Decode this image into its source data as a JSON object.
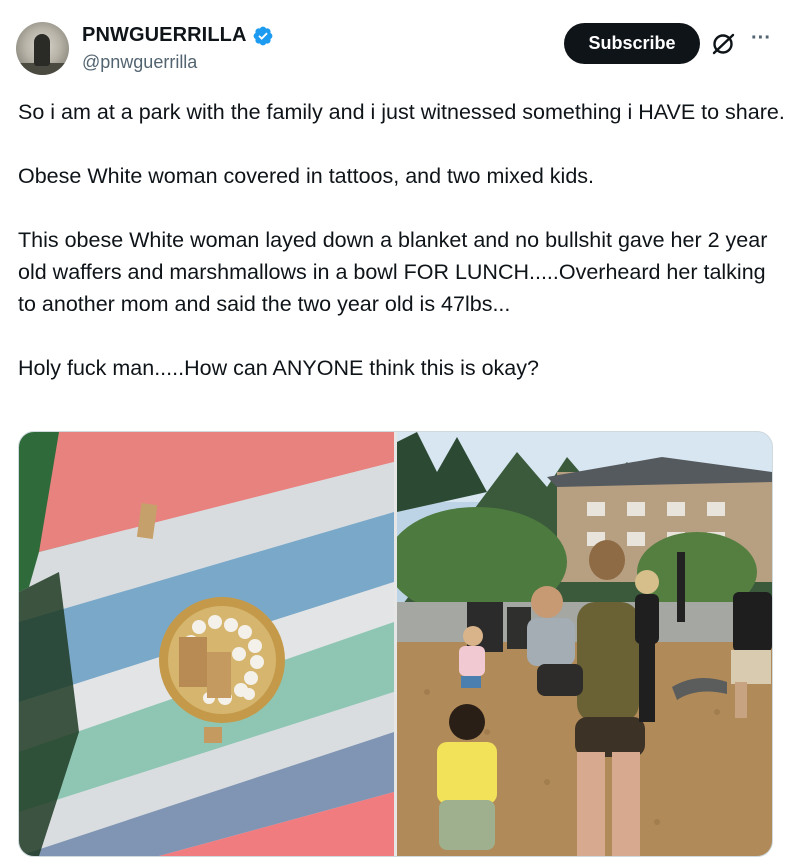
{
  "author": {
    "display_name": "PNWGUERRILLA",
    "handle": "@pnwguerrilla",
    "verified_icon": "verified-badge-icon",
    "verified_color": "#1d9bf0"
  },
  "actions": {
    "subscribe_label": "Subscribe",
    "grok_icon": "grok-icon",
    "more_icon": "more-icon",
    "more_glyph": "···"
  },
  "tweet": {
    "paragraphs": [
      "So i am at a park with the family and i just witnessed something i HAVE to share.",
      "Obese White woman covered in tattoos, and two mixed kids.",
      "This obese White woman layed down a blanket and no bullshit gave her 2 year old waffers and marshmallows in a bowl FOR LUNCH.....Overheard her talking to another mom and said the two year old is 47lbs...",
      "Holy fuck man.....How can ANYONE think this is okay?"
    ]
  },
  "media": {
    "images": [
      {
        "name": "photo-blanket-bowl"
      },
      {
        "name": "photo-park-playground"
      }
    ]
  },
  "colors": {
    "text": "#0f1419",
    "secondary_text": "#536471",
    "button_bg": "#0f1419",
    "border": "#cfd9de"
  }
}
